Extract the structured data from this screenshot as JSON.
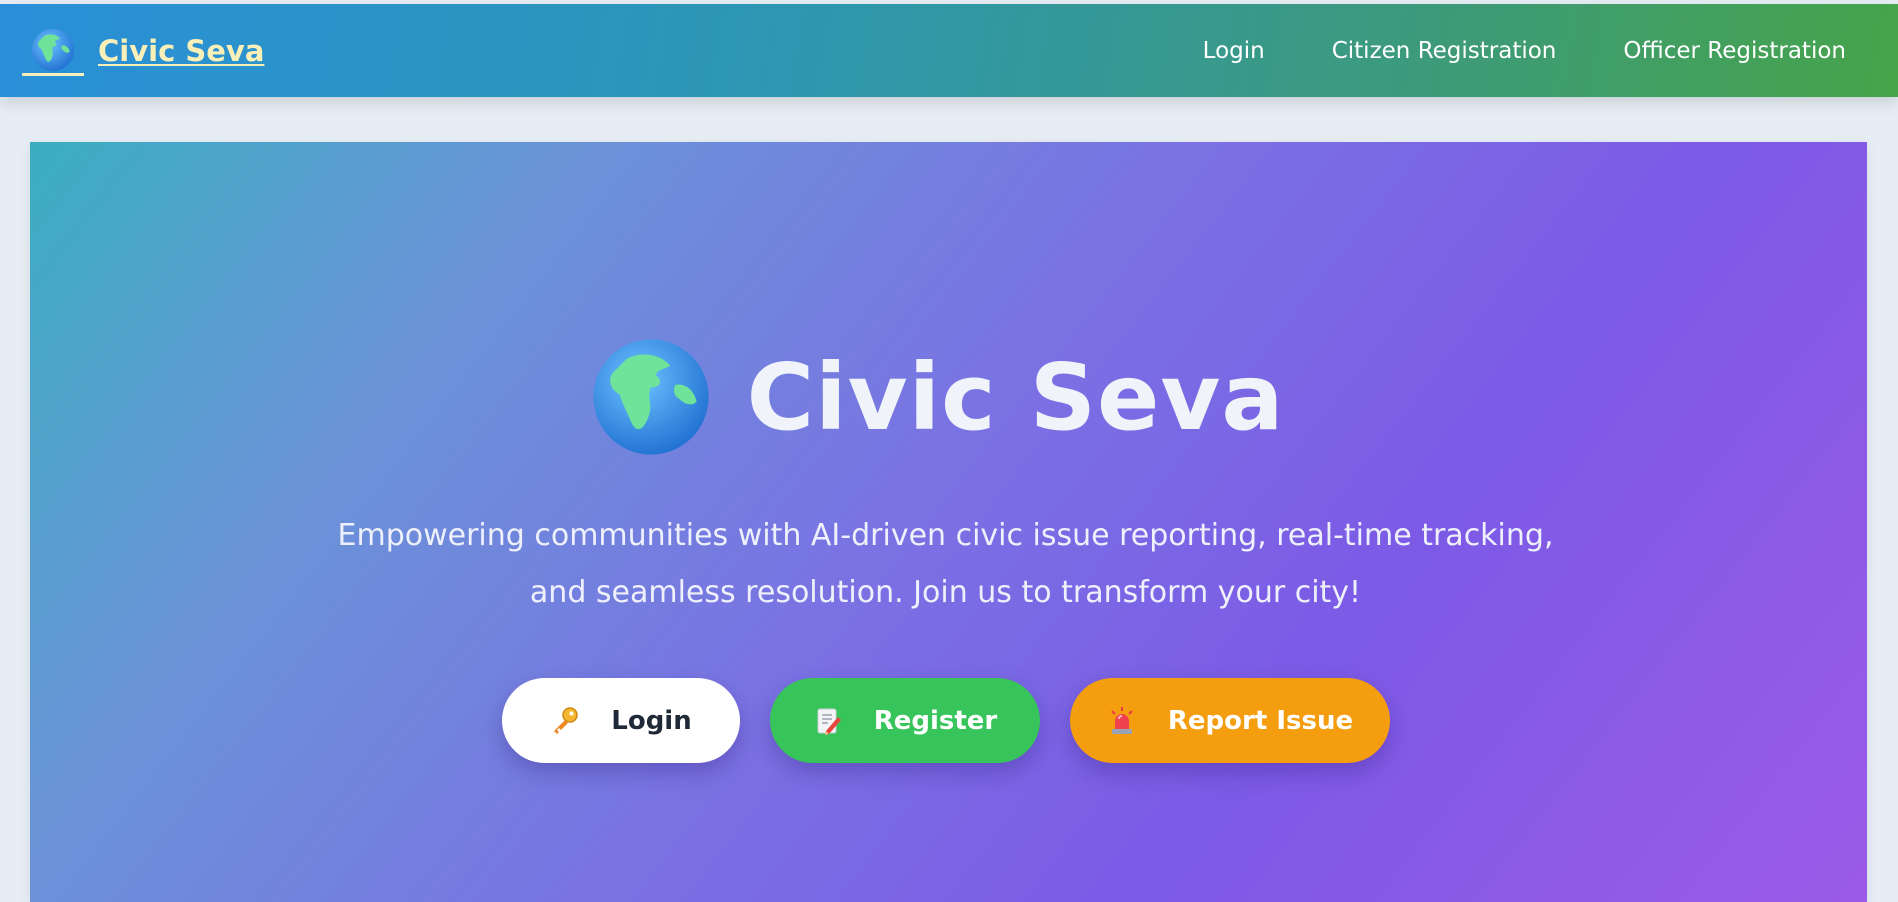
{
  "navbar": {
    "brand": "Civic Seva",
    "links": [
      "Login",
      "Citizen Registration",
      "Officer Registration"
    ]
  },
  "hero": {
    "title": "Civic Seva",
    "tagline_line1": "Empowering communities with AI-driven civic issue reporting, real-time tracking,",
    "tagline_line2": "and seamless resolution. Join us to transform your city!",
    "buttons": {
      "login": "Login",
      "register": "Register",
      "report": "Report Issue"
    }
  },
  "icons": {
    "brand": "globe-icon",
    "hero": "globe-icon",
    "login": "key-icon",
    "register": "memo-icon",
    "report": "siren-icon"
  },
  "colors": {
    "nav_start": "#2a8fd9",
    "nav_end": "#46a44a",
    "brand_text": "#f8f0b8",
    "register": "#37c45a",
    "report": "#f49e0f"
  }
}
